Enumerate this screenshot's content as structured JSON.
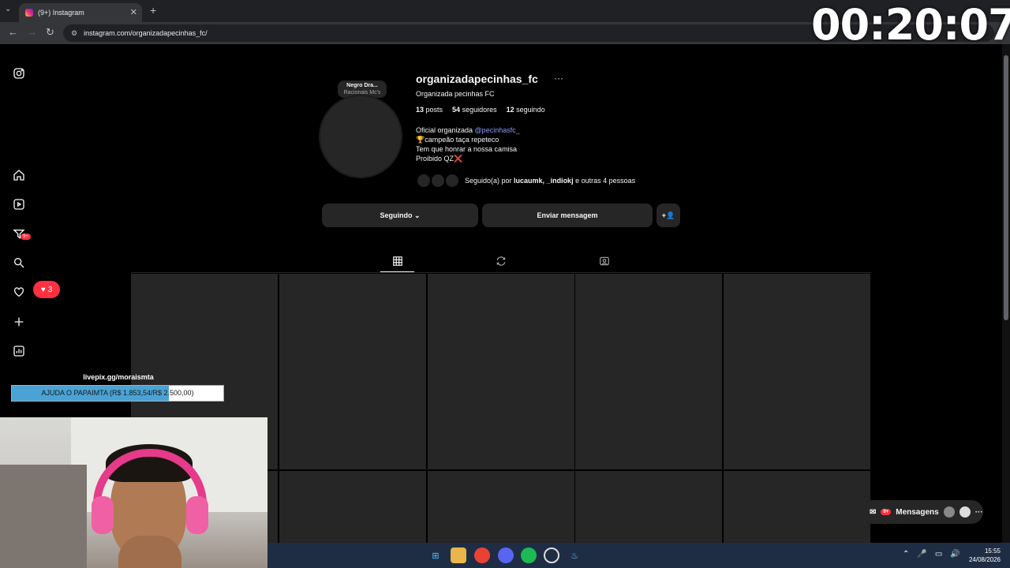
{
  "browser": {
    "tab_title": "(9+) Instagram",
    "url": "instagram.com/organizadapecinhas_fc/",
    "stream_timer": "00:20:07"
  },
  "sidebar": {
    "notif_badge": "9+",
    "likes_count": "3"
  },
  "profile": {
    "note_title": "Negro Dra...",
    "note_subtitle": "Racionais Mc's",
    "username": "organizadapecinhas_fc",
    "more": "···",
    "display_name": "Organizada pecinhas FC",
    "posts_count": "13",
    "posts_label": "posts",
    "followers_count": "54",
    "followers_label": "seguidores",
    "following_count": "12",
    "following_label": "seguindo",
    "bio_line1_prefix": "Oficial organizada ",
    "bio_mention": "@pecinhasfc_",
    "bio_line2": "🏆campeão taça repeteco",
    "bio_line3": "Tem que honrar a nossa camisa",
    "bio_line4": "Proibido QZ❌",
    "followed_by_prefix": "Seguido(a) por ",
    "followed_by_names": "lucaumk, _indiokj",
    "followed_by_suffix": " e outras 4 pessoas",
    "btn_following": "Seguindo ⌄",
    "btn_message": "Enviar mensagem"
  },
  "overlay": {
    "livepix_label": "livepix.gg/moraismta",
    "goal_text": "AJUDA O PAPAIMTA (R$ 1.853,54/R$ 2.500,00)",
    "goal_progress": 0.7414
  },
  "messages": {
    "label": "Mensagens",
    "badge": "9+"
  },
  "taskbar": {
    "time": "15:55",
    "date": "24/08/2026"
  }
}
